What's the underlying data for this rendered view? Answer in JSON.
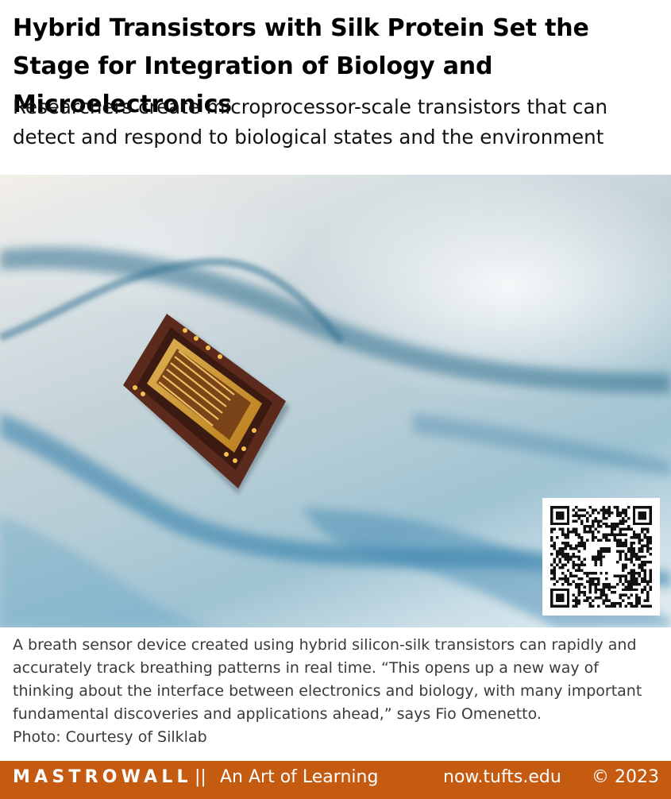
{
  "article": {
    "title": "Hybrid Transistors with Silk Protein Set the Stage for Integration of Biology and Microelectronics",
    "subtitle": "Researchers create microprocessor-scale transistors that can detect and respond to biological states and the environment"
  },
  "photo": {
    "caption_lines": [
      "A breath sensor device created using hybrid silicon-silk transistors can rapidly and",
      "accurately track breathing patterns in real time. “This opens up a new way of",
      "thinking about the interface between electronics and biology, with many important",
      "fundamental discoveries and applications ahead,” says Fio Omenetto."
    ],
    "credit": "Photo: Courtesy of Silklab"
  },
  "qr_code": {
    "icon": "dinosaur-icon"
  },
  "footer": {
    "brand": "MASTROWALL",
    "separator": "||",
    "tagline": "An Art of Learning",
    "site": "now.tufts.edu",
    "copyright": "© 2023"
  },
  "colors": {
    "footer_bg": "#c55a11",
    "footer_text": "#ffffff",
    "caption_text": "#3a3a3a"
  }
}
